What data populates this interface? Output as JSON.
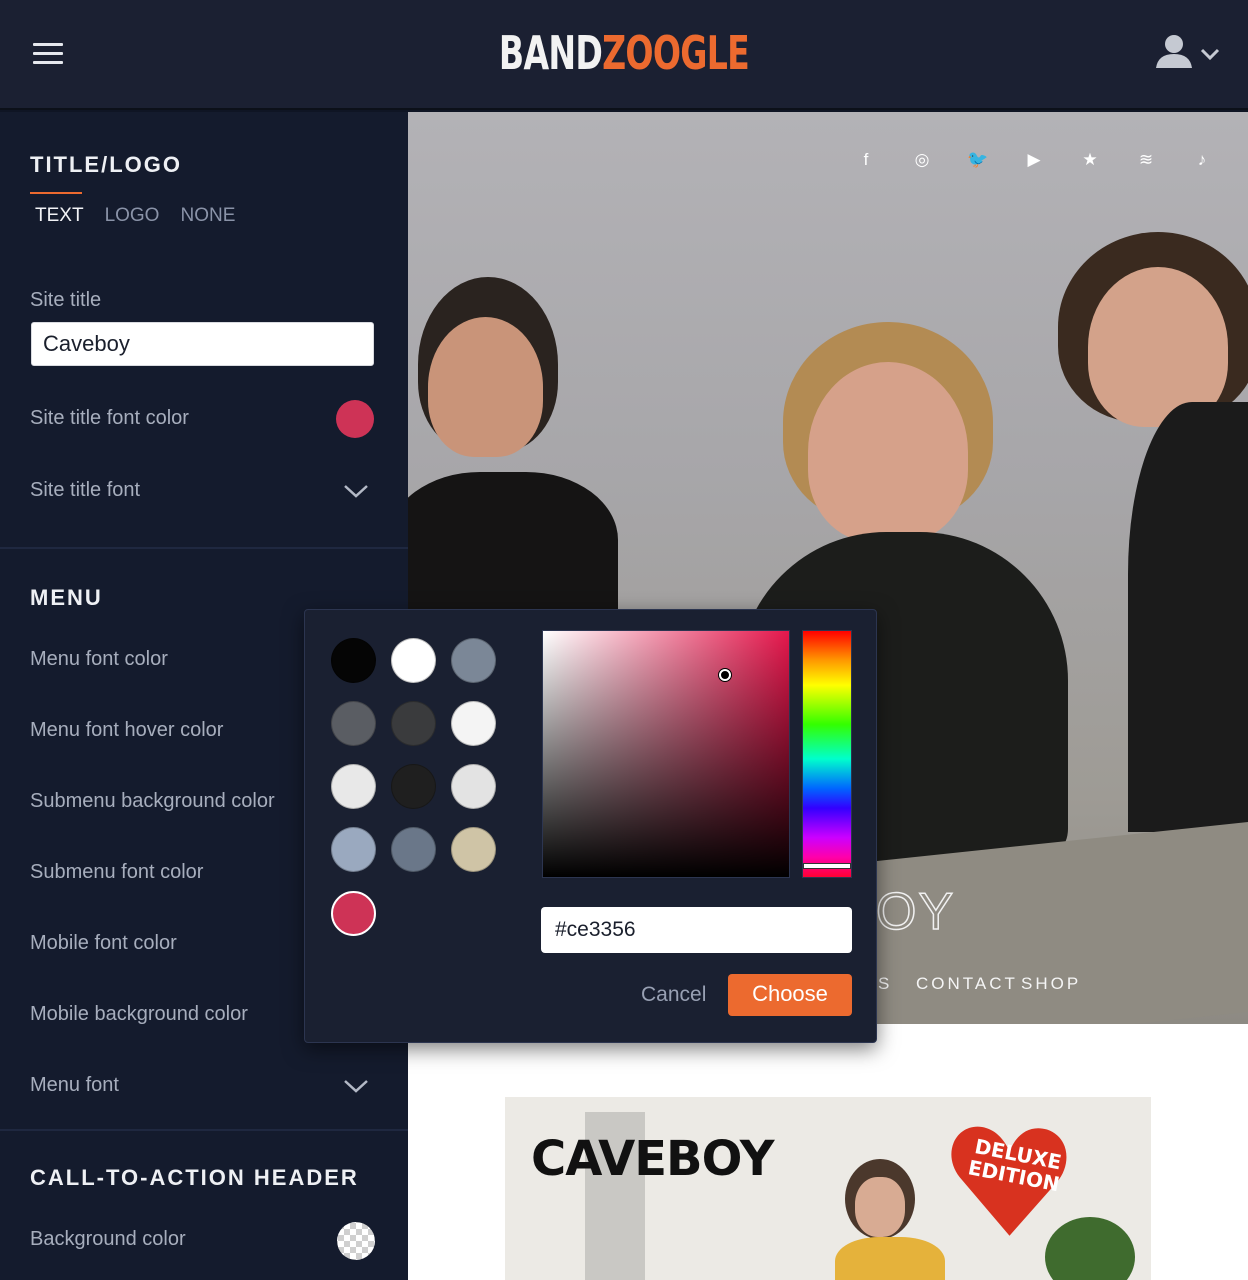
{
  "header": {
    "brand_part1": "BAND",
    "brand_part2": "ZOOGLE",
    "brand_colors": {
      "primary": "#f2f2f2",
      "accent": "#ec6a2f"
    },
    "menu_icon": "hamburger-icon",
    "user_icon": "user-icon"
  },
  "sidebar": {
    "title_logo": {
      "heading": "TITLE/LOGO",
      "tabs": [
        {
          "label": "TEXT",
          "active": true
        },
        {
          "label": "LOGO",
          "active": false
        },
        {
          "label": "NONE",
          "active": false
        }
      ],
      "site_title_label": "Site title",
      "site_title_value": "Caveboy",
      "font_color_label": "Site title font color",
      "font_color_value": "#ce3356",
      "font_label": "Site title font"
    },
    "menu": {
      "heading": "MENU",
      "items": [
        "Menu font color",
        "Menu font hover color",
        "Submenu background color",
        "Submenu font color",
        "Mobile font color",
        "Mobile background color"
      ],
      "font_label": "Menu font"
    },
    "cta_header": {
      "heading": "CALL-TO-ACTION HEADER",
      "background_label": "Background color"
    }
  },
  "color_picker": {
    "swatches": [
      "#050505",
      "#ffffff",
      "#7b8797",
      "#5a5d63",
      "#3a3b3d",
      "#f4f4f4",
      "#e8e8e8",
      "#1f1f1f",
      "#e3e3e3",
      "#9aa9bf",
      "#6a7789",
      "#cfc4a6",
      "#ce3356"
    ],
    "hue_base": "#e5174c",
    "hex_value": "#ce3356",
    "cancel_label": "Cancel",
    "choose_label": "Choose"
  },
  "preview": {
    "social_icons": [
      "facebook-icon",
      "instagram-icon",
      "twitter-icon",
      "youtube-icon",
      "star-icon",
      "spotify-icon",
      "music-note-icon"
    ],
    "social_glyphs": [
      "f",
      "◎",
      "🐦",
      "▶",
      "★",
      "≋",
      "♪"
    ],
    "site_title_partial": "OY",
    "nav_partial": "S",
    "nav_items": [
      "CONTACT",
      "SHOP"
    ],
    "album_title": "CAVEBOY",
    "badge_line1": "DELUXE",
    "badge_line2": "EDITION"
  }
}
